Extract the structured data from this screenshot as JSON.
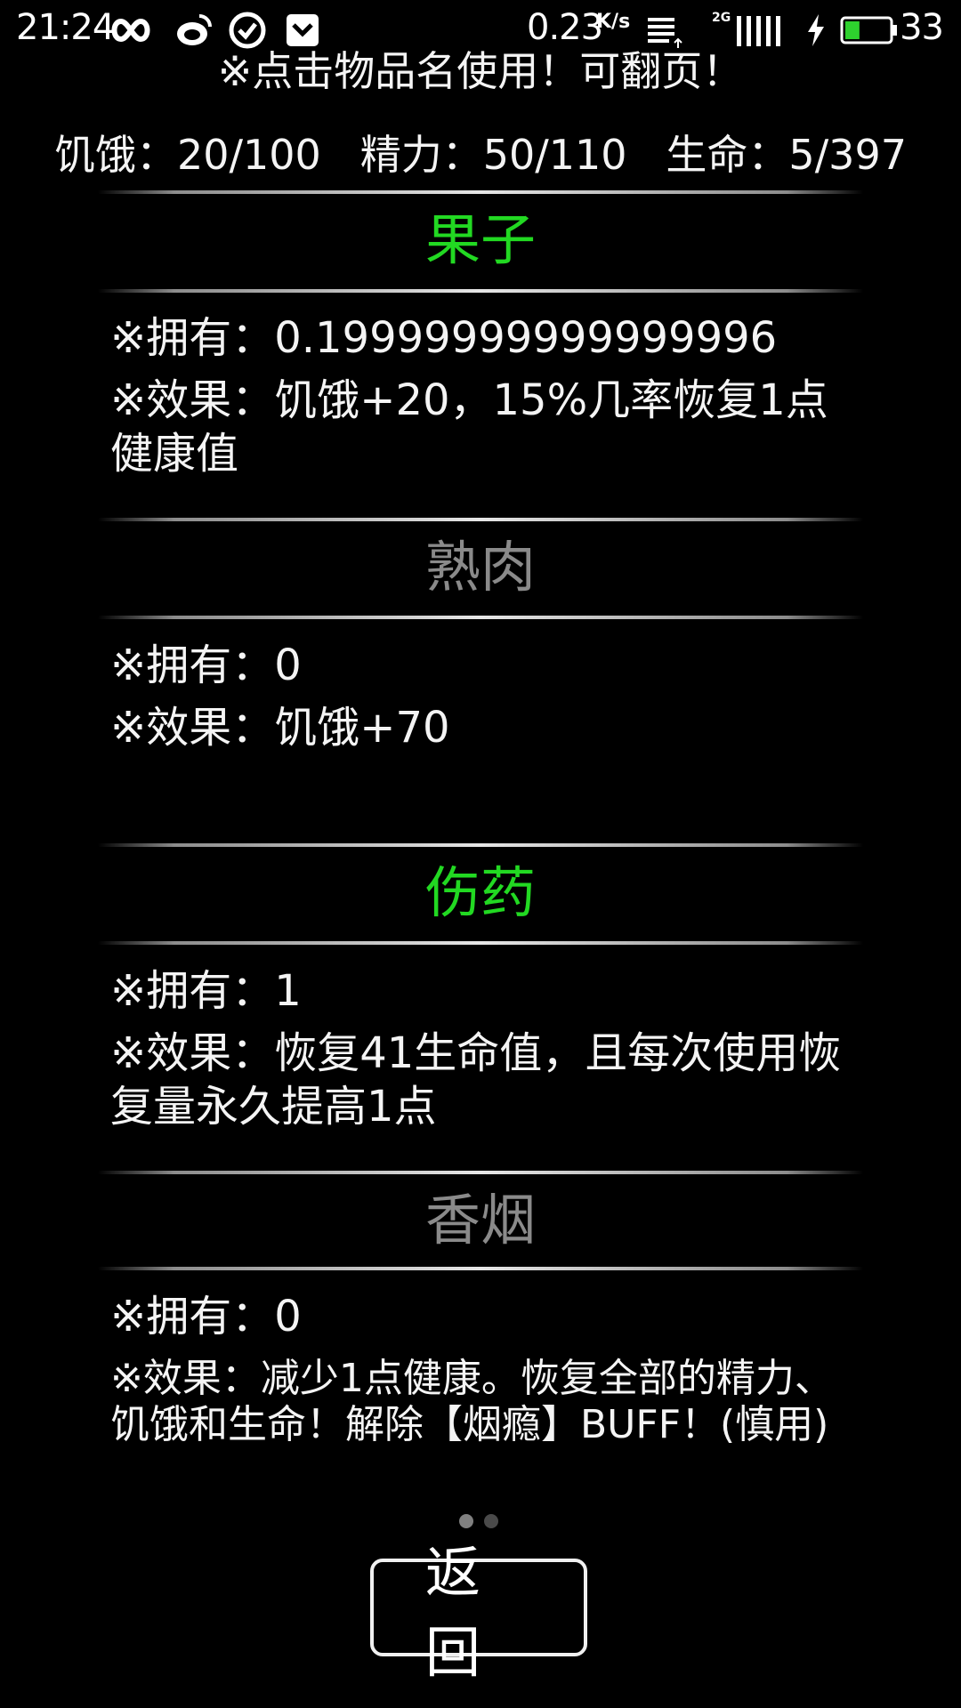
{
  "status_bar": {
    "time": "21:24",
    "net_speed": "0.23",
    "net_speed_unit": "K/s",
    "signal_label": "2G",
    "battery": "33",
    "icons": [
      "loop-icon",
      "weibo-icon",
      "check-circle-icon",
      "pocket-icon",
      "download-icon",
      "signal-icon",
      "charging-icon",
      "battery-icon"
    ],
    "battery_color": "#2ed12e"
  },
  "hint": "※点击物品名使用！可翻页！",
  "stats": {
    "hunger_label": "饥饿：",
    "hunger_value": "20/100",
    "energy_label": "精力：",
    "energy_value": "50/110",
    "life_label": "生命：",
    "life_value": "5/397"
  },
  "items": [
    {
      "name": "果子",
      "owned_line": "※拥有：0.19999999999999996",
      "effect_line": "※效果：饥饿+20，15%几率恢复1点健康值",
      "status": "available"
    },
    {
      "name": "熟肉",
      "owned_line": "※拥有：0",
      "effect_line": "※效果：饥饿+70",
      "status": "empty"
    },
    {
      "name": "伤药",
      "owned_line": "※拥有：1",
      "effect_line": "※效果：恢复41生命值，且每次使用恢复量永久提高1点",
      "status": "available"
    },
    {
      "name": "香烟",
      "owned_line": "※拥有：0",
      "effect_line": "※效果：减少1点健康。恢复全部的精力、饥饿和生命！解除【烟瘾】BUFF！(慎用)",
      "status": "empty"
    }
  ],
  "pager": {
    "page_count": 2,
    "current_page": 1
  },
  "back_label": "返回",
  "colors": {
    "available_name": "#22d922",
    "empty_name": "#8a8a8a",
    "background": "#000000"
  }
}
